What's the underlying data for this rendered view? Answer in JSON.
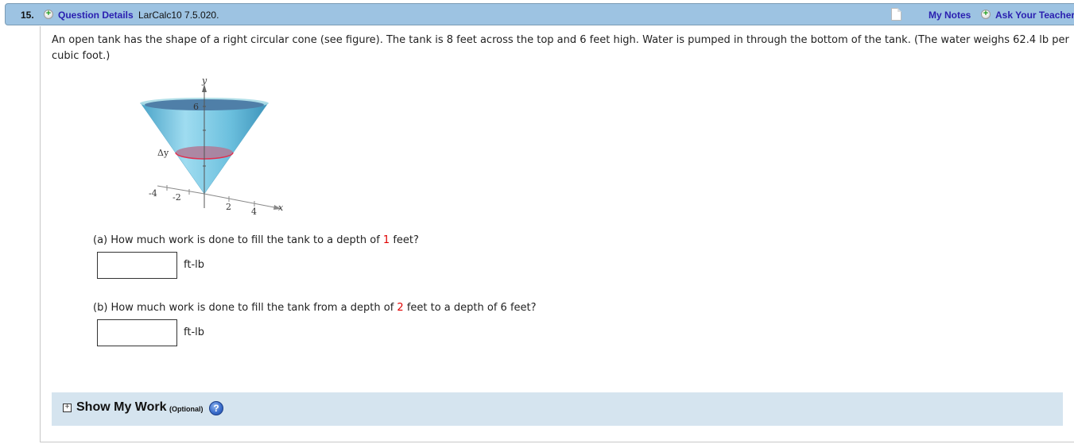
{
  "header": {
    "question_number": "15.",
    "question_details_label": "Question Details",
    "question_code": "LarCalc10 7.5.020.",
    "my_notes_label": "My Notes",
    "ask_teacher_label": "Ask Your Teacher",
    "plus_glyph": "+"
  },
  "problem": {
    "text": "An open tank has the shape of a right circular cone (see figure). The tank is 8 feet across the top and 6 feet high. Water is pumped in through the bottom of the tank. (The water weighs 62.4 lb per cubic foot.)"
  },
  "figure": {
    "y_axis_label": "y",
    "x_axis_label": "x",
    "y_tick_label": "6",
    "x_tick_labels": [
      "-4",
      "-2",
      "2",
      "4"
    ],
    "slice_label": "Δy",
    "colors": {
      "cone": "#5fb3d3",
      "water_surface": "#4f7fa8",
      "slice": "#e03050"
    }
  },
  "parts": [
    {
      "prefix": "(a) How much work is done to fill the tank to a depth of ",
      "highlight": "1",
      "suffix": " feet?",
      "answer_value": "",
      "unit": "ft-lb"
    },
    {
      "prefix": "(b) How much work is done to fill the tank from a depth of ",
      "highlight": "2",
      "suffix": " feet to a depth of 6 feet?",
      "answer_value": "",
      "unit": "ft-lb"
    }
  ],
  "show_work": {
    "expand_glyph": "+",
    "title": "Show My Work",
    "optional_label": "(Optional)",
    "help_glyph": "?"
  }
}
